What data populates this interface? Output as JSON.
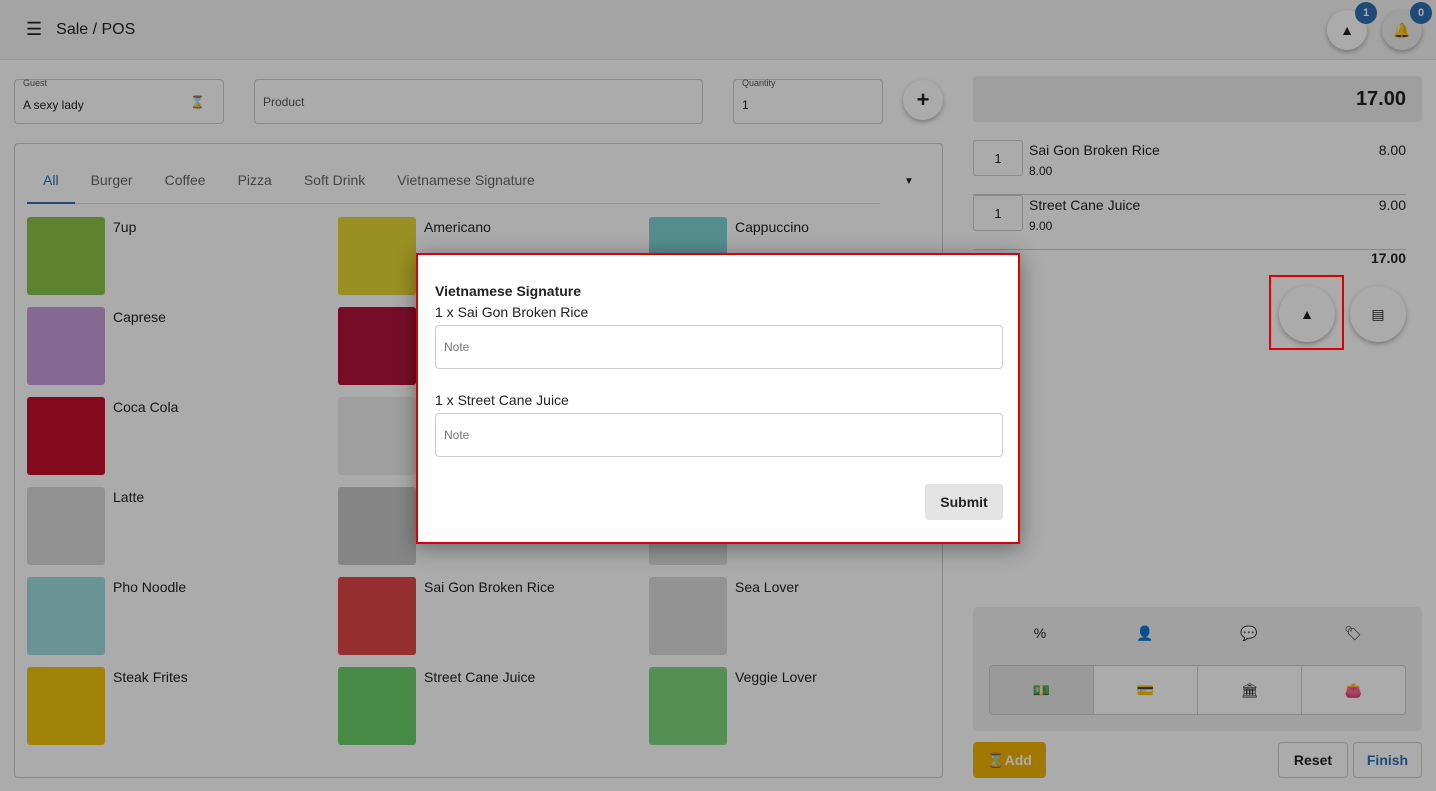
{
  "header": {
    "title": "Sale / POS",
    "menu_icon": "menu-icon",
    "orders_badge": "1",
    "notifications_badge": "0"
  },
  "form": {
    "guest_label": "Guest",
    "guest_value": "A sexy lady",
    "product_placeholder": "Product",
    "quantity_label": "Quantity",
    "quantity_value": "1"
  },
  "tabs": [
    "All",
    "Burger",
    "Coffee",
    "Pizza",
    "Soft Drink",
    "Vietnamese Signature"
  ],
  "products": [
    {
      "name": "7up",
      "color": "#8bc34a"
    },
    {
      "name": "Americano",
      "color": "#e5d534"
    },
    {
      "name": "Cappuccino",
      "color": "#7fd3d6"
    },
    {
      "name": "Caprese",
      "color": "#c79bd8"
    },
    {
      "name": "",
      "color": "#b0143c"
    },
    {
      "name": "",
      "color": "#ddd"
    },
    {
      "name": "Coca Cola",
      "color": "#c8102e"
    },
    {
      "name": "",
      "color": "#eee"
    },
    {
      "name": "",
      "color": "#ddd"
    },
    {
      "name": "Latte",
      "color": "#d9d9d9"
    },
    {
      "name": "",
      "color": "#c8c8c8"
    },
    {
      "name": "",
      "color": "#ddd"
    },
    {
      "name": "Pho Noodle",
      "color": "#9fdbe0"
    },
    {
      "name": "Sai Gon Broken Rice",
      "color": "#e04848"
    },
    {
      "name": "Sea Lover",
      "color": "#dcdcdc"
    },
    {
      "name": "Steak Frites",
      "color": "#f1c40f"
    },
    {
      "name": "Street Cane Juice",
      "color": "#6bcf6b"
    },
    {
      "name": "Veggie Lover",
      "color": "#7ed67e"
    }
  ],
  "cart": {
    "total": "17.00",
    "subtotal": "17.00",
    "lines": [
      {
        "qty": "1",
        "name": "Sai Gon Broken Rice",
        "price": "8.00",
        "total": "8.00"
      },
      {
        "qty": "1",
        "name": "Street Cane Juice",
        "price": "9.00",
        "total": "9.00"
      }
    ]
  },
  "actions": {
    "reset": "Reset",
    "finish": "Finish",
    "add": "Add"
  },
  "colors": {
    "accent": "#2f6fb3",
    "add_button": "#f0b400",
    "highlight": "#dd0000"
  },
  "modal": {
    "title": "Vietnamese Signature",
    "items": [
      "1 x Sai Gon Broken Rice",
      "1 x Street Cane Juice"
    ],
    "note_placeholder": "Note",
    "submit": "Submit"
  }
}
